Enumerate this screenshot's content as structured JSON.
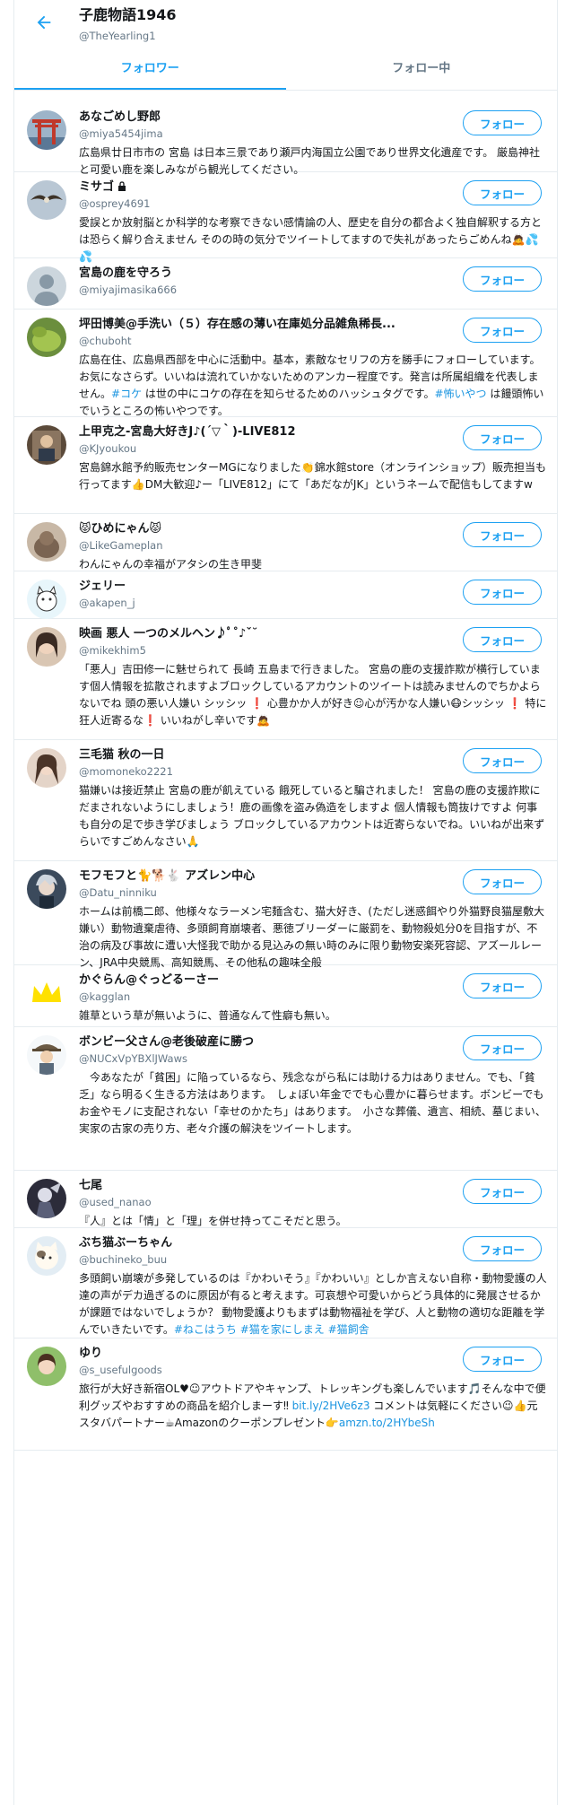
{
  "header": {
    "title": "子鹿物語1946",
    "handle": "@TheYearling1"
  },
  "tabs": [
    {
      "label": "フォロワー",
      "active": true
    },
    {
      "label": "フォロー中",
      "active": false
    }
  ],
  "follow_label": "フォロー",
  "colors": {
    "accent": "#1da1f2",
    "secondary_text": "#657786",
    "border": "#e6ecf0"
  },
  "users": [
    {
      "name": "あなごめし野郎",
      "handle": "@miya5454jima",
      "bio": "広島県廿日市市の 宮島 は日本三景であり瀬戸内海国立公園であり世界文化遺産です。 厳島神社と可愛い鹿を楽しみながら観光してください。",
      "avatar": "torii-gate-photo"
    },
    {
      "name": "ミサゴ",
      "locked": true,
      "handle": "@osprey4691",
      "bio": "愛誤とか放射脳とか科学的な考察できない感情論の人、歴史を自分の都合よく独自解釈する方とは恐らく解り合えません そのの時の気分でツイートしてますので失礼があったらごめんね🙇💦💦",
      "avatar": "osprey-photo"
    },
    {
      "name": "宮島の鹿を守ろう",
      "handle": "@miyajimasika666",
      "bio": "",
      "avatar": "default-profile"
    },
    {
      "name": "坪田博美@手洗い（５）存在感の薄い在庫処分品雑魚稀長...",
      "handle": "@chuboht",
      "bio": "広島在住、広島県西部を中心に活動中。基本，素敵なセリフの方を勝手にフォローしています。お気になさらず。いいねは流れていかないためのアンカー程度です。発言は所属組織を代表しません。#コケ は世の中にコケの存在を知らせるためのハッシュタグです。#怖いやつ は饅頭怖いでいうところの怖いやつです。",
      "avatar": "moss-photo"
    },
    {
      "name": "上甲克之-宮島大好きJ♪(´▽｀)-LIVE812",
      "handle": "@KJyoukou",
      "bio": "宮島錦水館予約販売センターMGになりました👏錦水館store（オンラインショップ）販売担当も行ってます👍DM大歓迎♪ー「LIVE812」にて「あだながJK」というネームで配信もしてますw",
      "avatar": "person-photo"
    },
    {
      "name": "😾ひめにゃん😾",
      "handle": "@LikeGameplan",
      "bio": "わんにゃんの幸福がアタシの生き甲斐",
      "avatar": "cat-photo"
    },
    {
      "name": "ジェリー",
      "handle": "@akapen_j",
      "bio": "",
      "avatar": "cartoon-cat"
    },
    {
      "name": "映画 悪人 一つのメルヘン♪ﾟ˚♪ˇ˘",
      "handle": "@mikekhim5",
      "bio": "「悪人」吉田修一に魅せられて 長崎 五島まで行きました。 宮島の鹿の支援詐欺が横行しています個人情報を拡散されますよブロックしているアカウントのツイートは読みませんのでちかよらないでね 頭の悪い人嫌い シッシッ ❗ 心豊かか人が好き☺心が汚かな人嫌い😷シッシッ ❗ 特に狂人近寄るな❗ いいねがし辛いです🙇",
      "avatar": "woman-photo"
    },
    {
      "name": "三毛猫 秋の一日",
      "handle": "@momoneko2221",
      "bio": "猫嫌いは接近禁止 宮島の鹿が飢えている 餓死していると騙されました！ 宮島の鹿の支援詐欺にだまされないようにしましょう！鹿の画像を盗み偽造をしますよ 個人情報も筒抜けですよ 何事も自分の足で歩き学びましょう ブロックしているアカウントは近寄らないでね。いいねが出来ずらいですごめんなさい🙏",
      "avatar": "woman-photo-2"
    },
    {
      "name": "モフモフと🐈🐕🐇 アズレン中心",
      "handle": "@Datu_ninniku",
      "bio": "ホームは前橋二郎、他様々なラーメン宅麺含む、猫大好き、(ただし迷惑餌やり外猫野良猫屋敷大嫌い）動物遺棄虐待、多頭飼育崩壊者、悪徳ブリーダーに厳罰を、動物殺処分0を目指すが、不治の病及び事故に遭い大怪我で助かる見込みの無い時のみに限り動物安楽死容認、アズールレーン、JRA中央競馬、高知競馬、その他私の趣味全般",
      "avatar": "character-art"
    },
    {
      "name": "かぐらん@ぐっどるーさー",
      "handle": "@kagglan",
      "bio": "雑草という草が無いように、普通なんて性癖も無い。",
      "avatar": "crown-icon"
    },
    {
      "name": "ボンビー父さん@老後破産に勝つ",
      "handle": "@NUCxVpYBXlJWaws",
      "bio": "　今あなたが「貧困」に陥っているなら、残念ながら私には助ける力はありません。でも、「貧乏」なら明るく生きる方法はあります。　しょぼい年金ででも心豊かに暮らせます。ボンビーでもお金やモノに支配されない「幸せのかたち」はあります。　小さな葬儀、遺言、相続、墓じまい、実家の古家の売り方、老々介護の解決をツイートします。",
      "avatar": "cartoon-man"
    },
    {
      "name": "七尾",
      "handle": "@used_nanao",
      "bio": "『人』とは「情」と「理」を併せ持ってこそだと思う。",
      "avatar": "anime-art"
    },
    {
      "name": "ぶち猫ぶーちゃん",
      "handle": "@buchineko_buu",
      "bio": "多頭飼い崩壊が多発しているのは『かわいそう』『かわいい』としか言えない自称・動物愛護の人達の声がデカ過ぎるのに原因が有ると考えます。可哀想や可愛いからどう具体的に発展させるかが課題ではないでしょうか？ 動物愛護よりもまずは動物福祉を学び、人と動物の適切な距離を学んでいきたいです。#ねこはうち #猫を家にしまえ #猫飼舎",
      "avatar": "cat-illustration"
    },
    {
      "name": "ゆり",
      "handle": "@s_usefulgoods",
      "bio": "旅行が大好き新宿OL♥☺アウトドアやキャンプ、トレッキングも楽しんでいます🎵そんな中で便利グッズやおすすめの商品を紹介しまーす‼ bit.ly/2HVe6z3 コメントは気軽にください😉👍元スタバパートナー☕Amazonのクーポンプレゼント👉amzn.to/2HYbeSh",
      "avatar": "woman-photo-3"
    }
  ]
}
